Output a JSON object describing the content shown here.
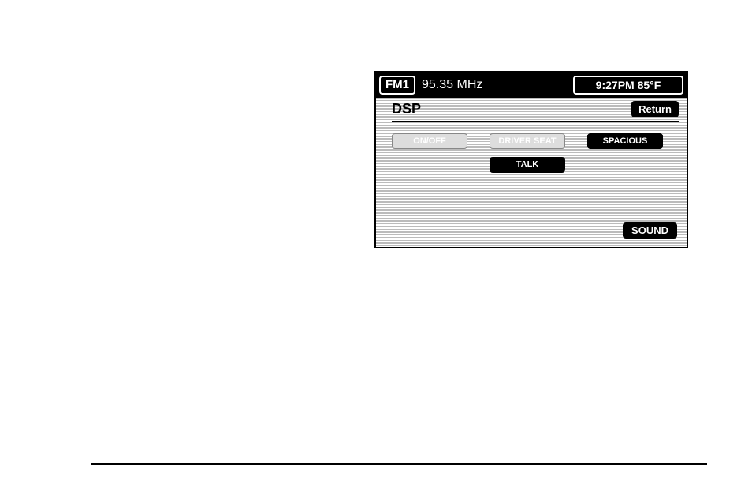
{
  "topbar": {
    "band": "FM1",
    "frequency": "95.35 MHz",
    "clock": "9:27PM 85°F"
  },
  "screen": {
    "title": "DSP",
    "return_label": "Return",
    "buttons": {
      "onoff": "ON/OFF",
      "driver_seat": "DRIVER SEAT",
      "spacious": "SPACIOUS",
      "talk": "TALK"
    },
    "sound_label": "SOUND"
  }
}
